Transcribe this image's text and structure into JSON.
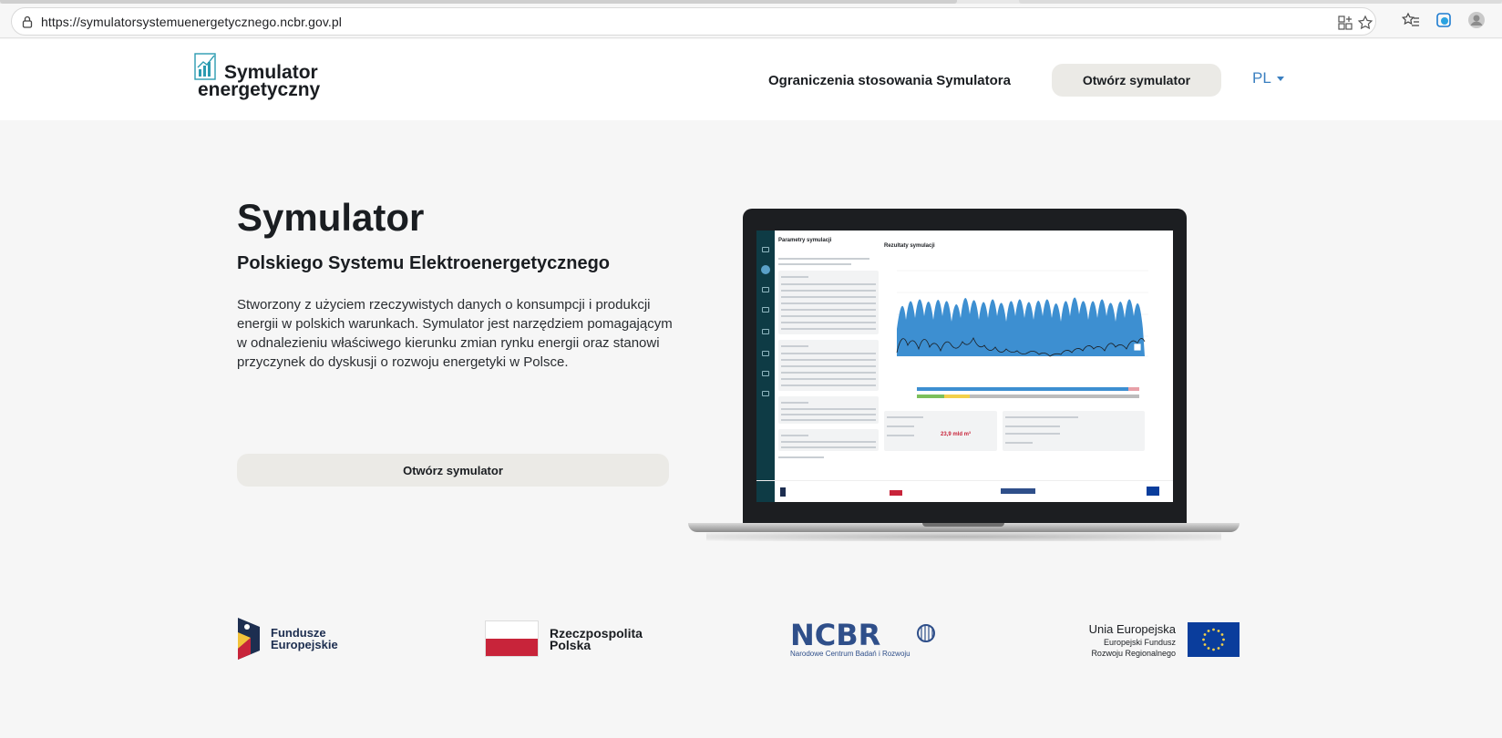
{
  "browser": {
    "url": "https://symulatorsystemuenergetycznego.ncbr.gov.pl"
  },
  "header": {
    "logo_line1": "Symulator",
    "logo_line2": "energetyczny",
    "nav_link": "Ograniczenia stosowania Symulatora",
    "open_button": "Otwórz symulator",
    "language": "PL"
  },
  "hero": {
    "title": "Symulator",
    "subtitle": "Polskiego Systemu Elektroenergetycznego",
    "description": "Stworzony z użyciem rzeczywistych danych o konsumpcji i produkcji energii w polskich warunkach. Symulator jest narzędziem pomagającym w odnalezieniu właściwego kierunku zmian rynku energii oraz stanowi przyczynek do dyskusji o rozwoju energetyki w Polsce.",
    "open_button": "Otwórz symulator"
  },
  "preview": {
    "left_title": "Parametry symulacji",
    "right_title": "Rezultaty symulacji",
    "value_highlight": "23,9 mld m³",
    "accent": "#3d8fd1",
    "sidebar_color": "#0e3b45"
  },
  "footer": {
    "fe_line1": "Fundusze",
    "fe_line2": "Europejskie",
    "rp_line1": "Rzeczpospolita",
    "rp_line2": "Polska",
    "ncbr_name": "NCBR",
    "ncbr_sub": "Narodowe Centrum Badań i Rozwoju",
    "ue_title": "Unia Europejska",
    "ue_sub1": "Europejski Fundusz",
    "ue_sub2": "Rozwoju Regionalnego"
  }
}
